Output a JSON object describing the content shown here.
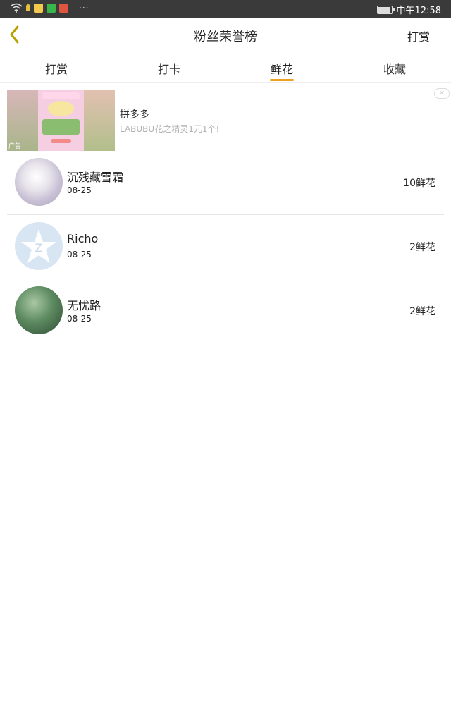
{
  "status_bar": {
    "time": "中午12:58",
    "more": "···",
    "battery_level": 0.85
  },
  "header": {
    "title": "粉丝荣誉榜",
    "action": "打赏"
  },
  "tabs": [
    {
      "label": "打赏",
      "active": false
    },
    {
      "label": "打卡",
      "active": false
    },
    {
      "label": "鲜花",
      "active": true
    },
    {
      "label": "收藏",
      "active": false
    }
  ],
  "ad": {
    "tag": "广告",
    "title": "拼多多",
    "description": "LABUBU花之精灵1元1个!",
    "close": "✕"
  },
  "list": [
    {
      "name": "沉残藏雪霜",
      "date": "08-25",
      "count": "10鲜花"
    },
    {
      "name": "Richo",
      "date": "08-25",
      "count": "2鲜花"
    },
    {
      "name": "无忧路",
      "date": "08-25",
      "count": "2鲜花"
    }
  ],
  "colors": {
    "accent": "#f0a020",
    "back_arrow": "#b8a000",
    "status_bar": "#3a3a3a"
  }
}
